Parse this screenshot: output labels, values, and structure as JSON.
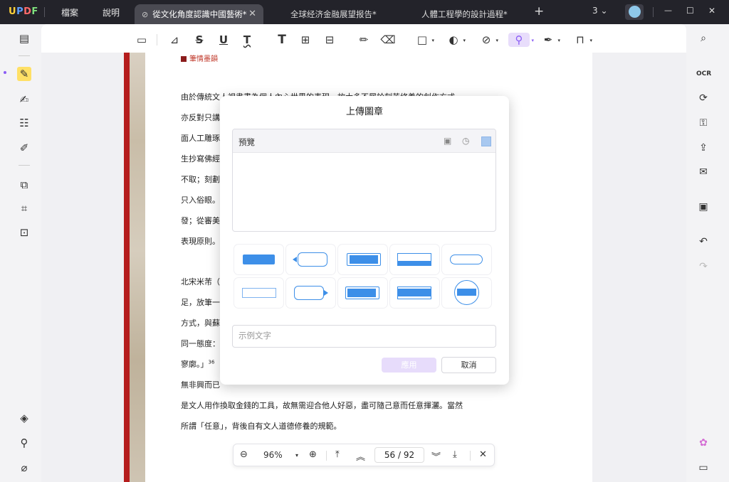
{
  "app": {
    "logo": "UPDF",
    "logo_parts": [
      "U",
      "P",
      "D",
      "F"
    ]
  },
  "menu": {
    "file": "檔案",
    "help": "說明"
  },
  "tabs": [
    {
      "label": "從文化角度認識中國藝術*",
      "active": true
    },
    {
      "label": "全球经济金融展望报告*",
      "active": false
    },
    {
      "label": "人體工程學的設計過程*",
      "active": false
    }
  ],
  "titlebar": {
    "new_tab": "+",
    "tab_count": "3",
    "tab_count_chevron": "⌄",
    "minimize": "—",
    "maximize": "☐",
    "close": "✕"
  },
  "toolbar": {
    "underline_T": "T",
    "text_T": "T",
    "strike_S": "S",
    "underline_U": "U"
  },
  "document": {
    "header_label": "筆情墨韻",
    "lines": [
      "由於傳統文人視書畫為個人內心世界的表現，故大多不屑於刻苦修養的創作方式，",
      "亦反對只講",
      "面人工雕琢",
      "生抄寫佛經",
      "不取；刻劃",
      "只入俗眼。",
      "發；從審美",
      "表現原則。",
      "北宋米芾（",
      "足，放筆一",
      "方式，與蘇",
      "同一態度：",
      "寥廓。」",
      "無非興而已",
      "是文人用作換取金錢的工具，故無需迎合他人好惡，盡可隨己意而任意揮灑。當然",
      "所謂「任意」，背後自有文人道德修養的規範。"
    ],
    "footnote": "36"
  },
  "dialog": {
    "title": "上傳圖章",
    "preview_label": "預覽",
    "placeholder": "示例文字",
    "apply": "應用",
    "cancel": "取消",
    "stamps": [
      "filled-rect",
      "outline-flag-left",
      "filled-flag-left",
      "band-rect",
      "pill-outline",
      "thin-rect",
      "outline-flag-right",
      "filled-flag-right",
      "filled-band",
      "circle-band"
    ]
  },
  "bottombar": {
    "zoom": "96%",
    "current_page": "56",
    "separator": "/",
    "total_pages": "92"
  },
  "colors": {
    "accent": "#8a5cf5",
    "stamp_blue": "#3d8fe8",
    "titlebar": "#23232a"
  }
}
